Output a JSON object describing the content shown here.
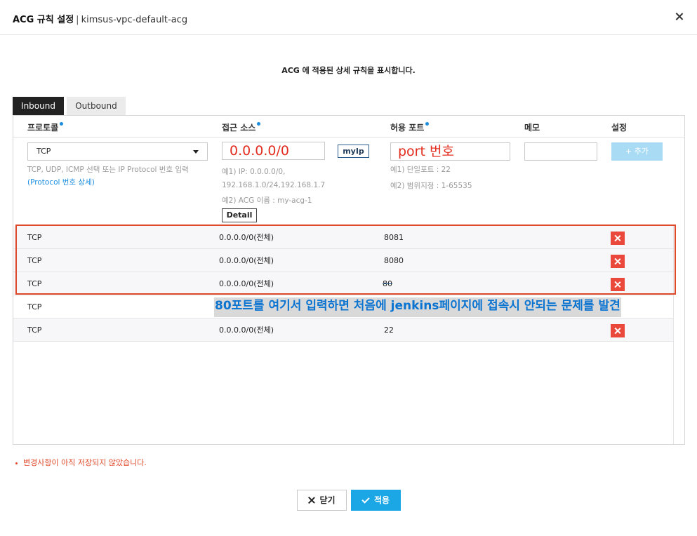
{
  "header": {
    "title": "ACG 규칙 설정",
    "separator": "|",
    "subtitle": "kimsus-vpc-default-acg",
    "close_icon": "close-icon"
  },
  "description": "ACG 에 적용된 상세 규칙을 표시합니다.",
  "tabs": [
    {
      "label": "Inbound",
      "active": true
    },
    {
      "label": "Outbound",
      "active": false
    }
  ],
  "columns": {
    "protocol": "프로토콜",
    "source": "접근 소스",
    "port": "허용 포트",
    "memo": "메모",
    "settings": "설정"
  },
  "form": {
    "protocol_value": "TCP",
    "protocol_hint": "TCP, UDP, ICMP 선택 또는 IP Protocol 번호 입력",
    "protocol_link": "Protocol 번호 상세",
    "link_open": "(",
    "link_close": ")",
    "source_value": "0.0.0.0/0",
    "myip_label": "myIp",
    "source_hint_1": "예1) IP: 0.0.0.0/0,",
    "source_hint_2": "192.168.1.0/24,192.168.1.7",
    "source_hint_3": "예2) ACG 이름 : my-acg-1",
    "detail_label": "Detail",
    "port_value": "port 번호",
    "port_hint_1": "예1) 단일포트 : 22",
    "port_hint_2": "예2) 범위지정 : 1-65535",
    "memo_value": "",
    "add_label": "+ 추가"
  },
  "rules": [
    {
      "protocol": "TCP",
      "source": "0.0.0.0/0(전체)",
      "port": "8081",
      "deletable": true
    },
    {
      "protocol": "TCP",
      "source": "0.0.0.0/0(전체)",
      "port": "8080",
      "deletable": true
    },
    {
      "protocol": "TCP",
      "source": "0.0.0.0/0(전체)",
      "port": "80",
      "deletable": true
    },
    {
      "protocol": "TCP",
      "source": "",
      "port": "",
      "deletable": false
    },
    {
      "protocol": "TCP",
      "source": "0.0.0.0/0(전체)",
      "port": "22",
      "deletable": true
    }
  ],
  "annotation": "80포트를 여기서 입력하면 처음에 jenkins페이지에 접속시 안되는 문제를 발견",
  "unsaved_notice": "변경사항이 아직 저장되지 않았습니다.",
  "footer": {
    "close_label": "닫기",
    "apply_label": "적용"
  },
  "colors": {
    "accent": "#1ba6e6",
    "danger": "#e9483b",
    "annotation_text": "#0b74d1",
    "highlight_border": "#e04a2c"
  }
}
